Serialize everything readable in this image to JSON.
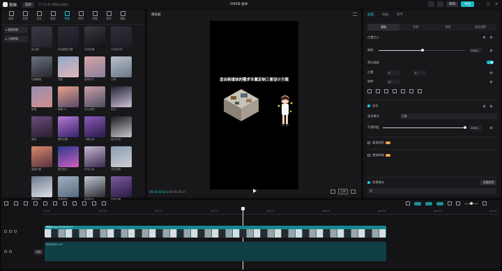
{
  "titlebar": {
    "app_name": "剪映",
    "menu_label": "菜单",
    "autosave": "17:19:45 草稿自动保存",
    "doc_title": "6月8日-副本",
    "share_label": "审阅",
    "export_label": "导出"
  },
  "media": {
    "toolbar": [
      {
        "label": "媒体",
        "icon": "media-icon",
        "active": false
      },
      {
        "label": "音频",
        "icon": "audio-icon",
        "active": false
      },
      {
        "label": "文本",
        "icon": "text-icon",
        "active": false
      },
      {
        "label": "贴纸",
        "icon": "sticker-icon",
        "active": false
      },
      {
        "label": "特效",
        "icon": "effects-icon",
        "active": true
      },
      {
        "label": "转场",
        "icon": "transition-icon",
        "active": false
      },
      {
        "label": "滤镜",
        "icon": "filter-icon",
        "active": false
      },
      {
        "label": "调节",
        "icon": "adjust-icon",
        "active": false
      },
      {
        "label": "模板",
        "icon": "template-icon",
        "active": false
      }
    ],
    "side": [
      {
        "label": "▸ 画面特效",
        "active": true
      },
      {
        "label": "▸ 人物特效",
        "active": true
      }
    ],
    "items": [
      {
        "label": "放大镜",
        "c1": "#3b3b45",
        "c2": "#22222a"
      },
      {
        "label": "彩色图层光晕",
        "c1": "#2d2d38",
        "c2": "#1a1a22"
      },
      {
        "label": "闪光玫瑰",
        "c1": "#3a3a44",
        "c2": "#121216"
      },
      {
        "label": "5分钟计时",
        "c1": "#30303a",
        "c2": "#1b1b22"
      },
      {
        "label": "玩偶模组",
        "c1": "#6b7280",
        "c2": "#25252b"
      },
      {
        "label": "变脸",
        "c1": "#8fa8c8",
        "c2": "#e5b7b7"
      },
      {
        "label": "旋转粒子",
        "c1": "#d7a3a8",
        "c2": "#8a7f9a"
      },
      {
        "label": "大雪",
        "c1": "#b9c2cc",
        "c2": "#6b7684"
      },
      {
        "label": "玻璃",
        "c1": "#9a8fb0",
        "c2": "#cf8f8f"
      },
      {
        "label": "模糊 02",
        "c1": "#e7a08a",
        "c2": "#5a4a6a"
      },
      {
        "label": "负片滤镜",
        "c1": "#c9a0a8",
        "c2": "#4c4c60"
      },
      {
        "label": "彩虹",
        "c1": "#222232",
        "c2": "#d0c0d8"
      },
      {
        "label": "暗焰",
        "c1": "#6a4c7a",
        "c2": "#2a1d30"
      },
      {
        "label": "爆炸四散",
        "c1": "#b37ad0",
        "c2": "#3a2070"
      },
      {
        "label": "飞碟光效",
        "c1": "#8a5ab8",
        "c2": "#2a1a4a"
      },
      {
        "label": "高光彩排",
        "c1": "#1a1a22",
        "c2": "#c8c8cc"
      },
      {
        "label": "高级切割",
        "c1": "#d88a6a",
        "c2": "#5a3040"
      },
      {
        "label": "复古胶片",
        "c1": "#2a3a8a",
        "c2": "#d060c0"
      },
      {
        "label": "彩色火焰",
        "c1": "#c6b8d2",
        "c2": "#3a2a50"
      },
      {
        "label": "流光变焦",
        "c1": "#8a9cb0",
        "c2": "#d0d0d6"
      },
      {
        "label": "爆炸碎片",
        "c1": "#6a7a90",
        "c2": "#e0e0e4"
      },
      {
        "label": "双重虚化",
        "c1": "#9fb0c4",
        "c2": "#5a6a80"
      },
      {
        "label": "城市胶片",
        "c1": "#c0c8d2",
        "c2": "#2a2a32"
      },
      {
        "label": "色彩分离",
        "c1": "#7a5aa0",
        "c2": "#2a1a40"
      }
    ]
  },
  "player": {
    "title": "播放器",
    "headline": "适合新媒体的需求专属定制三套设计方案",
    "time_current": "00:00:18:02",
    "time_total": "00:00:30:27",
    "ratio_label": "比例"
  },
  "inspector": {
    "tabs": [
      {
        "label": "画面",
        "active": true
      },
      {
        "label": "动画",
        "active": false
      },
      {
        "label": "调节",
        "active": false
      }
    ],
    "sub_tabs": [
      {
        "label": "基础",
        "active": true
      },
      {
        "label": "抠像",
        "active": false
      },
      {
        "label": "蒙版",
        "active": false
      },
      {
        "label": "画面调整",
        "active": false
      }
    ],
    "section_position": "位置大小",
    "scale_label": "缩放",
    "scale_value": "100%",
    "scale_fraction": 0.5,
    "uniform_label": "等比缩放",
    "pos_label": "位置",
    "pos_x": "0",
    "pos_y": "0",
    "rotate_label": "旋转",
    "rotate_value": "0°",
    "section_blend": "混合",
    "blend_mode_label": "混合模式",
    "blend_mode_value": "正常",
    "opacity_label": "不透明度",
    "opacity_value": "100%",
    "opacity_fraction": 1.0,
    "denoise_label": "超清画质",
    "stabilize_label": "视频降噪",
    "vip_label": "VIP",
    "section_bg": "背景填充",
    "bg_value": "无",
    "apply_all": "全部应用"
  },
  "timeline": {
    "ticks": [
      "00:00",
      "|00:05",
      "|00:10",
      "|00:15",
      "|00:20",
      "|00:25",
      "|00:30",
      "|00:35",
      "|00:40"
    ],
    "clip_label": "新媒体.mp4  00:00:30:27",
    "cover_label": "封面",
    "audio_label": "新媒体音频.mp3"
  },
  "colors": {
    "accent": "#19c6d4",
    "clip": "#1a7f88"
  }
}
